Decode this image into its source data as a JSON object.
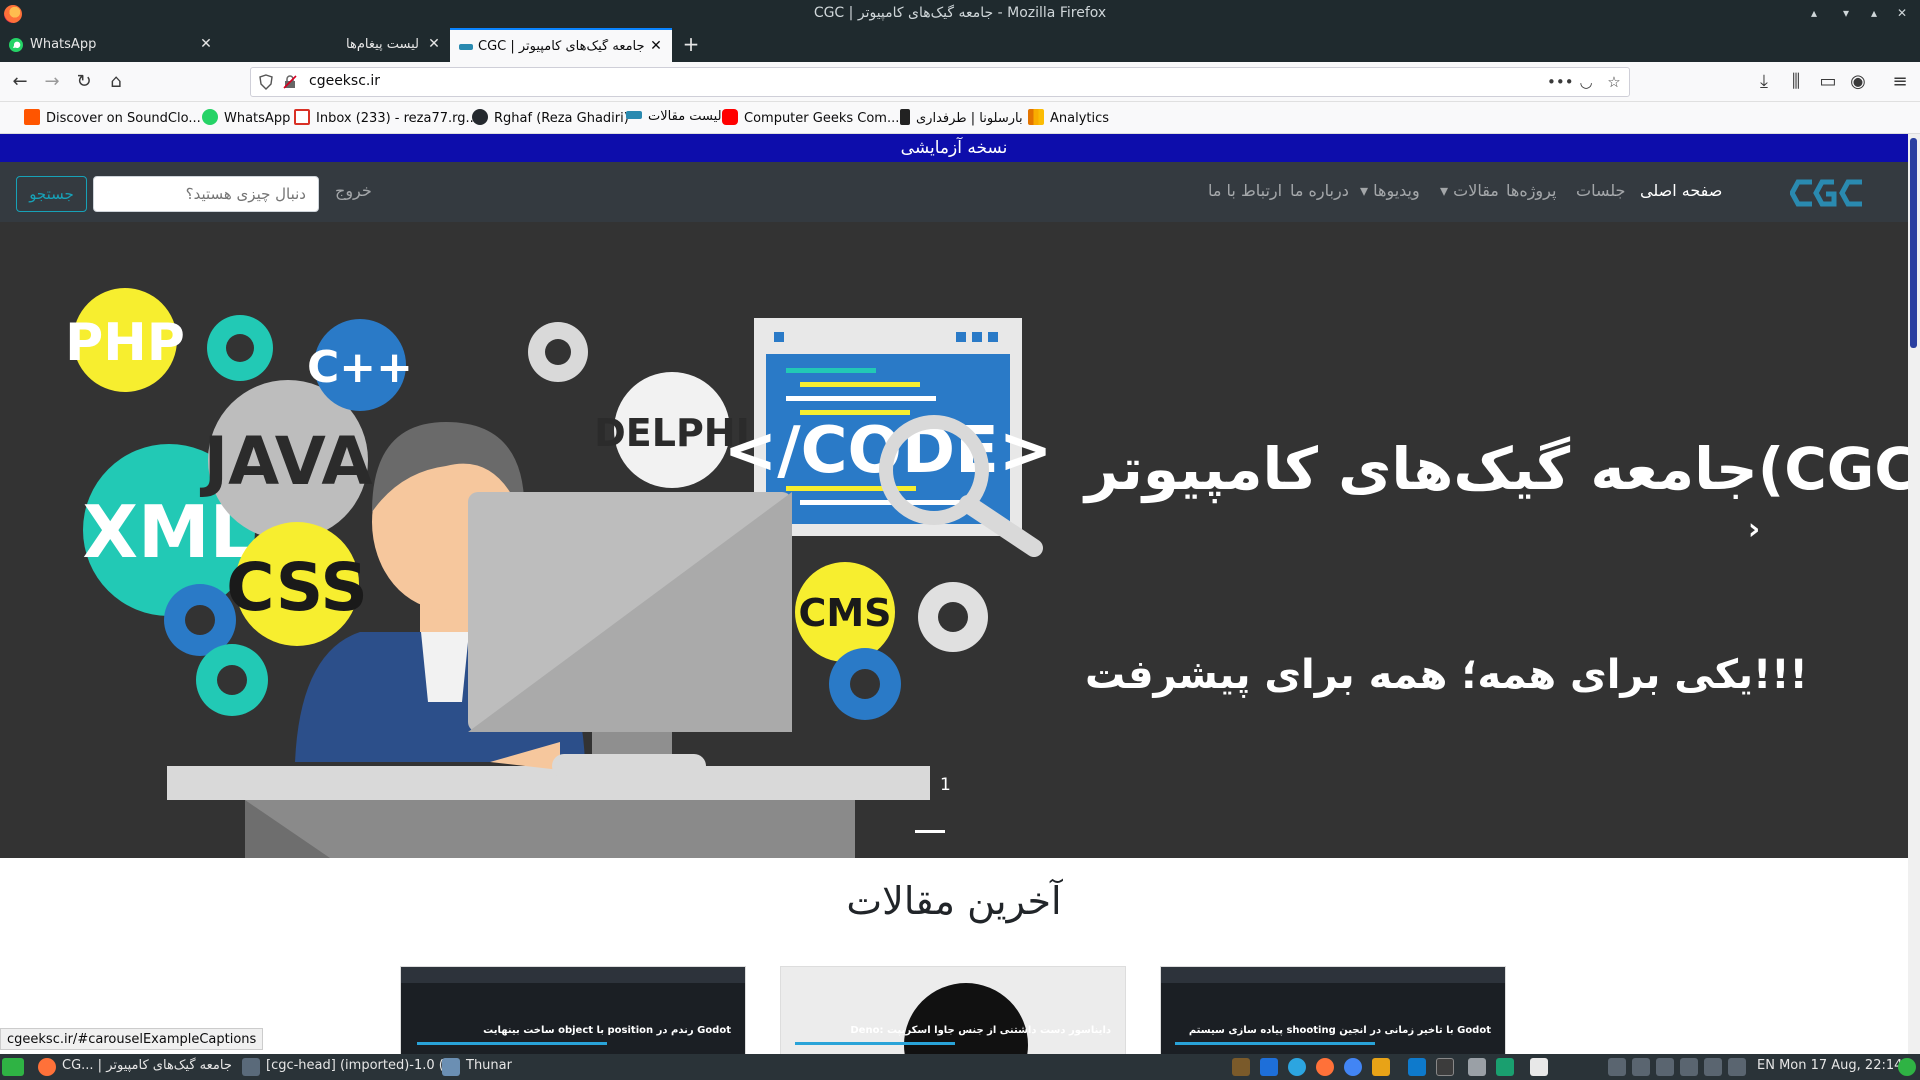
{
  "window": {
    "title": "CGC | جامعه گیک‌های کامپیوتر - Mozilla Firefox"
  },
  "tabs": [
    {
      "label": "WhatsApp"
    },
    {
      "label": "لیست پیغام‌ها"
    },
    {
      "label": "CGC | جامعه گیک‌های کامپیوتر"
    }
  ],
  "urlbar": {
    "url": "cgeeksc.ir"
  },
  "bookmarks": [
    {
      "label": "Discover on SoundClo...",
      "color": "#ff5500"
    },
    {
      "label": "WhatsApp",
      "color": "#25d366"
    },
    {
      "label": "Inbox (233) - reza77.rg...",
      "color": "#d93025"
    },
    {
      "label": "Rghaf (Reza Ghadiri)",
      "color": "#24292e"
    },
    {
      "label": "لیست مقالات",
      "color": "#2a8ab0"
    },
    {
      "label": "Computer Geeks Com...",
      "color": "#ff0000"
    },
    {
      "label": "بارسلونا | طرفداری",
      "color": "#222222"
    },
    {
      "label": "Analytics",
      "color": "#f9ab00"
    }
  ],
  "site": {
    "demo_banner": "نسخه آزمایشی",
    "nav": {
      "home": "صفحه اصلی",
      "sessions": "جلسات",
      "projects": "پروژه‌ها",
      "articles": "مقالات",
      "videos": "ویدیوها",
      "about": "درباره ما",
      "contact": "ارتباط با ما",
      "logout": "خروج",
      "search_placeholder": "دنبال چیزی هستید؟",
      "search_button": "جستجو"
    },
    "hero": {
      "title": "جامعه گیک‌های کامپیوتر(CGC)",
      "subtitle": "یکی برای همه؛ همه برای پیشرفت!!!",
      "counter": "1",
      "art_labels": [
        "PHP",
        "JAVA",
        "C++",
        "XML",
        "CSS",
        "DELPHI",
        "CMS",
        "</CODE>"
      ]
    },
    "latest_title": "آخرین مقالات",
    "cards": [
      {
        "caption": "ساخت بینهایت object با position رندم در Godot"
      },
      {
        "caption": "Deno: دایناسور دست داشتنی از جنس جاوا اسکریپت"
      },
      {
        "caption": "پیاده سازی سیستم shooting با تاخیر زمانی در انجین Godot"
      }
    ]
  },
  "status_bar": {
    "link": "cgeeksc.ir/#carouselExampleCaptions"
  },
  "taskbar": {
    "firefox_item": "CG... | جامعه گیک‌های کامپیوتر",
    "vm_item": "[cgc-head] (imported)-1.0 (...",
    "thunar_item": "Thunar",
    "clock": "EN  Mon 17 Aug, 22:14"
  }
}
